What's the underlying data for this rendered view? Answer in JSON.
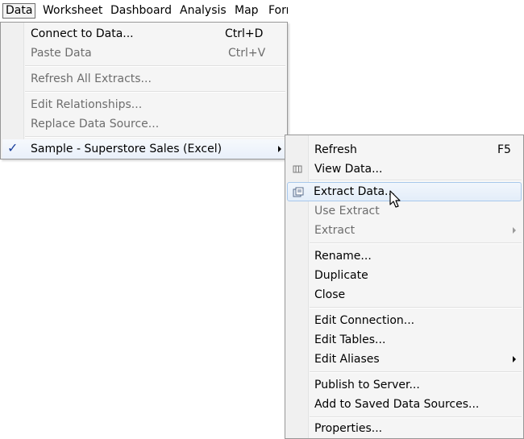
{
  "menubar": {
    "items": [
      "Data",
      "Worksheet",
      "Dashboard",
      "Analysis",
      "Map",
      "Format"
    ]
  },
  "data_menu": {
    "connect": {
      "label": "Connect to Data...",
      "shortcut": "Ctrl+D"
    },
    "paste": {
      "label": "Paste Data",
      "shortcut": "Ctrl+V"
    },
    "refresh_all": {
      "label": "Refresh All Extracts..."
    },
    "edit_relationships": {
      "label": "Edit Relationships..."
    },
    "replace_source": {
      "label": "Replace Data Source..."
    },
    "source": {
      "label": "Sample - Superstore Sales (Excel)",
      "check": "✓"
    }
  },
  "submenu": {
    "refresh": {
      "label": "Refresh",
      "shortcut": "F5"
    },
    "view_data": {
      "label": "View Data...",
      "icon": "table-icon"
    },
    "extract_data": {
      "label": "Extract Data...",
      "icon": "extract-icon"
    },
    "use_extract": {
      "label": "Use Extract"
    },
    "extract": {
      "label": "Extract"
    },
    "rename": {
      "label": "Rename..."
    },
    "duplicate": {
      "label": "Duplicate"
    },
    "close": {
      "label": "Close"
    },
    "edit_connection": {
      "label": "Edit Connection..."
    },
    "edit_tables": {
      "label": "Edit Tables..."
    },
    "edit_aliases": {
      "label": "Edit Aliases"
    },
    "publish": {
      "label": "Publish to Server..."
    },
    "add_saved": {
      "label": "Add to Saved Data Sources..."
    },
    "properties": {
      "label": "Properties..."
    }
  },
  "colors": {
    "highlight_border": "#a8c8ec",
    "check": "#1a3f9c",
    "disabled_text": "#6d6d6d"
  }
}
